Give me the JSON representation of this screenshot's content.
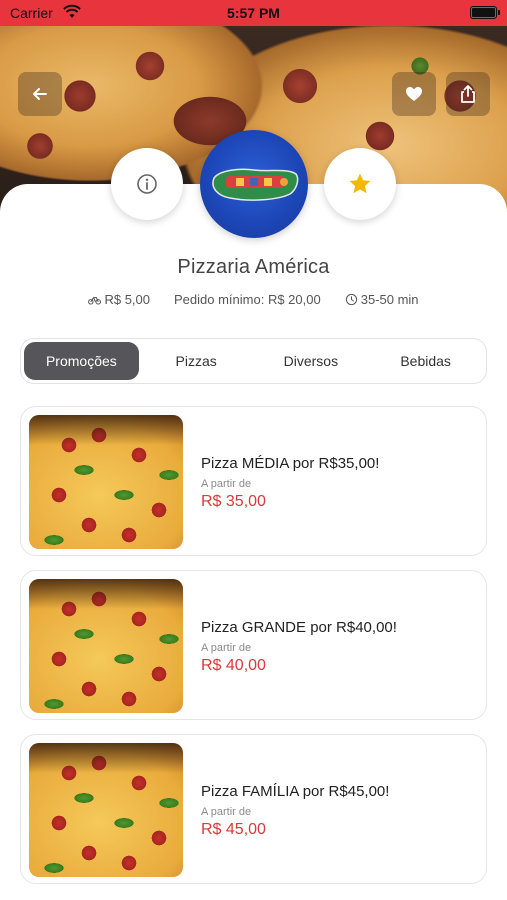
{
  "status_bar": {
    "carrier": "Carrier",
    "time": "5:57 PM"
  },
  "header": {
    "back_icon": "arrow-left-icon",
    "favorite_icon": "heart-icon",
    "share_icon": "share-icon",
    "info_icon": "info-icon",
    "rating_icon": "star-icon",
    "accent_color": "#e8343c",
    "star_color": "#f5b800"
  },
  "store": {
    "name": "Pizzaria América",
    "delivery_fee": "R$ 5,00",
    "minimum_order": "Pedido mínimo: R$ 20,00",
    "delivery_time": "35-50 min"
  },
  "tabs": [
    {
      "label": "Promoções",
      "active": true
    },
    {
      "label": "Pizzas",
      "active": false
    },
    {
      "label": "Diversos",
      "active": false
    },
    {
      "label": "Bebidas",
      "active": false
    }
  ],
  "products": [
    {
      "title": "Pizza MÉDIA por R$35,00!",
      "from_label": "A partir de",
      "price": "R$ 35,00"
    },
    {
      "title": "Pizza GRANDE por R$40,00!",
      "from_label": "A partir de",
      "price": "R$ 40,00"
    },
    {
      "title": "Pizza FAMÍLIA por R$45,00!",
      "from_label": "A partir de",
      "price": "R$ 45,00"
    }
  ]
}
